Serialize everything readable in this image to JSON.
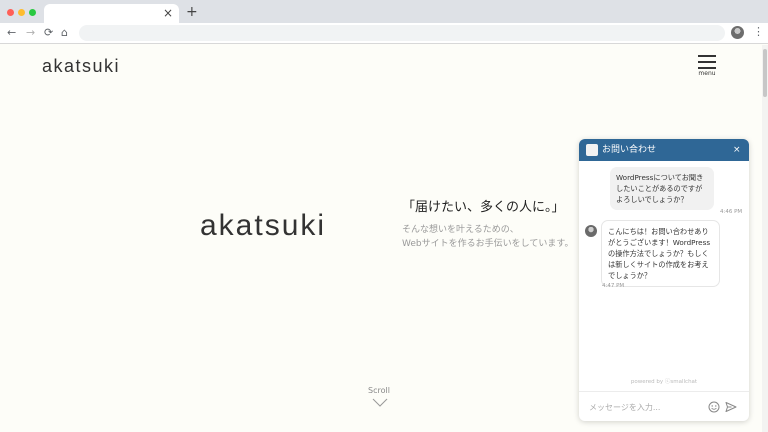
{
  "browser": {
    "tab_close": "×",
    "new_tab": "+",
    "nav": {
      "back": "←",
      "forward": "→",
      "reload": "⟳",
      "home": "⌂",
      "menu": "⋮"
    }
  },
  "header": {
    "logo": "akatsuki",
    "menu_label": "menu"
  },
  "hero": {
    "logo": "akatsuki",
    "tagline": "「届けたい、多くの人に。」",
    "desc_line1": "そんな想いを叶えるための、",
    "desc_line2": "Webサイトを作るお手伝いをしています。",
    "scroll_label": "Scroll"
  },
  "chat": {
    "title": "お問い合わせ",
    "close": "×",
    "messages": [
      {
        "text": "WordPressについてお聞きしたいことがあるのですがよろしいでしょうか？",
        "time": "4:46 PM"
      },
      {
        "text": "こんにちは！お問い合わせありがとうございます！WordPressの操作方法でしょうか？もしくは新しくサイトの作成をお考えでしょうか？",
        "time": "4:47 PM"
      }
    ],
    "powered": "powered by ⓒsmallchat",
    "input_placeholder": "メッセージを入力..."
  },
  "colors": {
    "chat_header": "#2f6796",
    "page_bg": "#fdfdf8"
  }
}
